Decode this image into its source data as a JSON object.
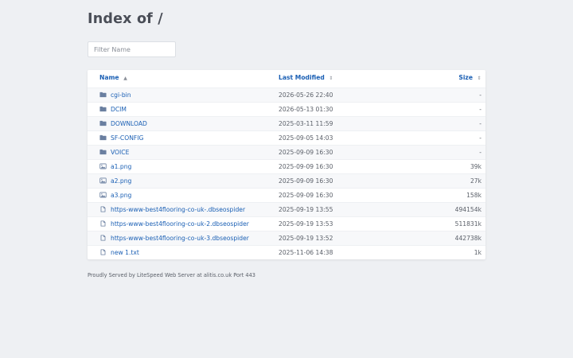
{
  "page": {
    "title": "Index of /",
    "filter_placeholder": "Filter Name",
    "footer": "Proudly Served by LiteSpeed Web Server at alitis.co.uk Port 443"
  },
  "table": {
    "headers": {
      "name": "Name",
      "modified": "Last Modified",
      "size": "Size",
      "name_sort_icon": "sort-up-icon",
      "modified_sort_icon": "sort-both-icon",
      "size_sort_icon": "sort-both-icon"
    },
    "rows": [
      {
        "icon": "folder-icon",
        "name": "cgi-bin",
        "modified": "2026-05-26 22:40",
        "size": "-"
      },
      {
        "icon": "folder-icon",
        "name": "DCIM",
        "modified": "2026-05-13 01:30",
        "size": "-"
      },
      {
        "icon": "folder-icon",
        "name": "DOWNLOAD",
        "modified": "2025-03-11 11:59",
        "size": "-"
      },
      {
        "icon": "folder-icon",
        "name": "SF-CONFIG",
        "modified": "2025-09-05 14:03",
        "size": "-"
      },
      {
        "icon": "folder-icon",
        "name": "VOICE",
        "modified": "2025-09-09 16:30",
        "size": "-"
      },
      {
        "icon": "image-icon",
        "name": "a1.png",
        "modified": "2025-09-09 16:30",
        "size": "39k"
      },
      {
        "icon": "image-icon",
        "name": "a2.png",
        "modified": "2025-09-09 16:30",
        "size": "27k"
      },
      {
        "icon": "image-icon",
        "name": "a3.png",
        "modified": "2025-09-09 16:30",
        "size": "158k"
      },
      {
        "icon": "file-icon",
        "name": "https-www-best4flooring-co-uk-.dbseospider",
        "modified": "2025-09-19 13:55",
        "size": "494154k"
      },
      {
        "icon": "file-icon",
        "name": "https-www-best4flooring-co-uk-2.dbseospider",
        "modified": "2025-09-19 13:53",
        "size": "511831k"
      },
      {
        "icon": "file-icon",
        "name": "https-www-best4flooring-co-uk-3.dbseospider",
        "modified": "2025-09-19 13:52",
        "size": "442738k"
      },
      {
        "icon": "file-icon",
        "name": "new 1.txt",
        "modified": "2025-11-06 14:38",
        "size": "1k"
      }
    ]
  },
  "colors": {
    "background": "#eef0f3",
    "link": "#1a5fb4",
    "icon": "#6a7fa0"
  }
}
